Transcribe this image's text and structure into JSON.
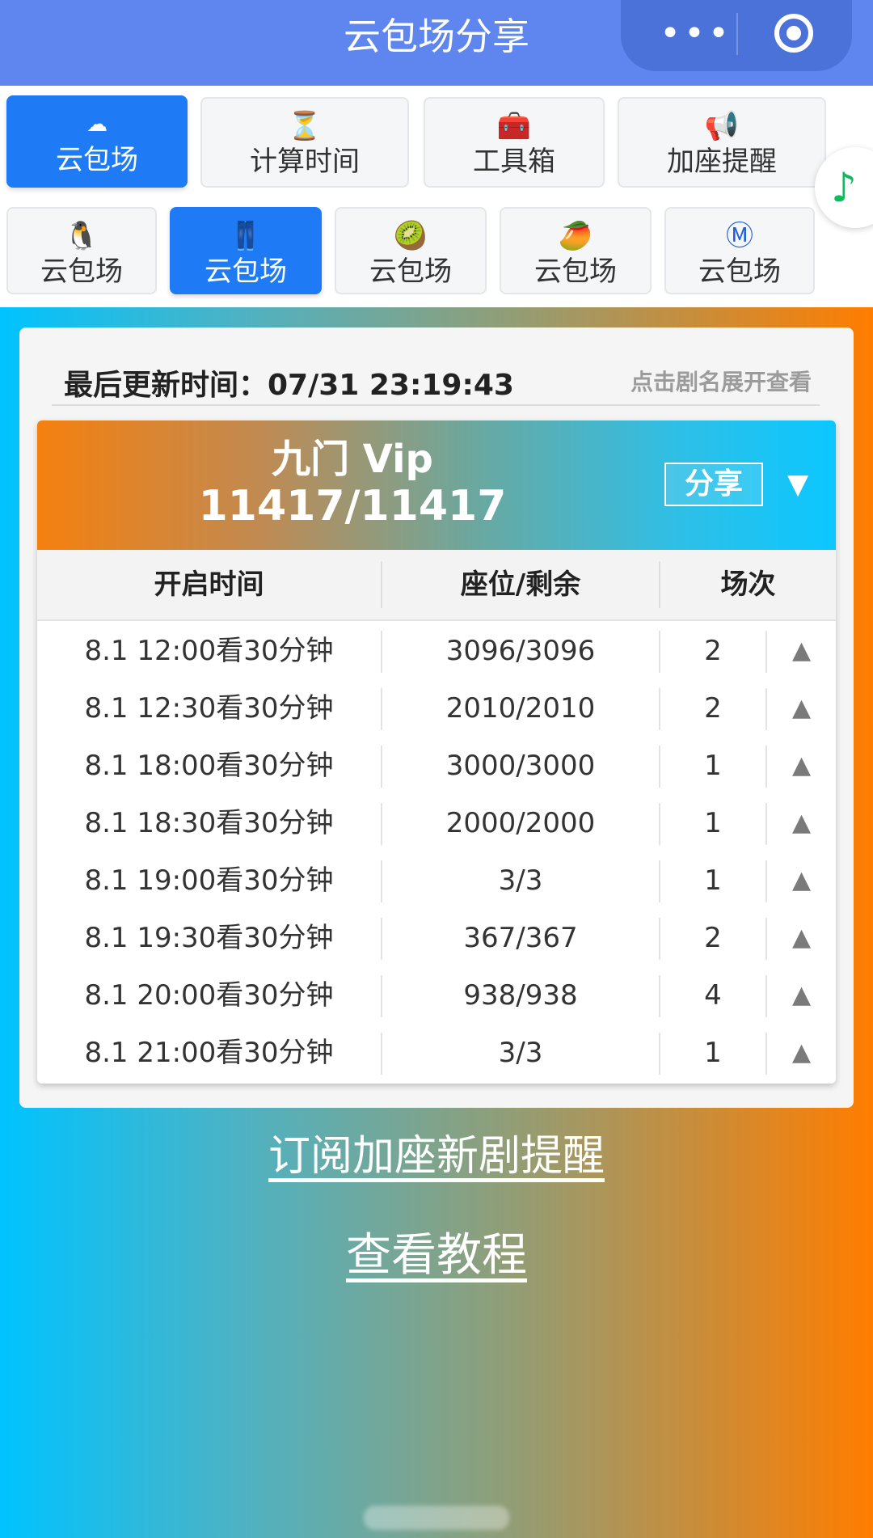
{
  "app": {
    "title": "云包场分享",
    "more_glyph": "•••"
  },
  "tabs_row1": [
    {
      "icon": "cloud-icon",
      "glyph": "☁",
      "label": "云包场",
      "active": true
    },
    {
      "icon": "hourglass-icon",
      "glyph": "⏳",
      "label": "计算时间",
      "active": false
    },
    {
      "icon": "toolbox-icon",
      "glyph": "🧰",
      "label": "工具箱",
      "active": false
    },
    {
      "icon": "megaphone-icon",
      "glyph": "📢",
      "label": "加座提醒",
      "active": false
    }
  ],
  "tabs_row2": [
    {
      "icon": "penguin-icon",
      "glyph": "🐧",
      "label": "云包场",
      "active": false
    },
    {
      "icon": "jeans-icon",
      "glyph": "👖",
      "label": "云包场",
      "active": true
    },
    {
      "icon": "kiwi-icon",
      "glyph": "🥝",
      "label": "云包场",
      "active": false
    },
    {
      "icon": "mango-icon",
      "glyph": "🥭",
      "label": "云包场",
      "active": false
    },
    {
      "icon": "m-circle-icon",
      "glyph": "Ⓜ",
      "label": "云包场",
      "active": false
    }
  ],
  "music": {
    "icon": "music-note-icon",
    "glyph": "♪",
    "color": "#12b85e"
  },
  "card": {
    "update_label": "最后更新时间：07/31 23:19:43",
    "hint": "点击剧名展开查看"
  },
  "show": {
    "title": "九门 Vip",
    "count": "11417/11417",
    "share_label": "分享",
    "expand_glyph": "▼"
  },
  "table": {
    "headers": [
      "开启时间",
      "座位/剩余",
      "场次"
    ],
    "rows": [
      {
        "time": "8.1 12:00看30分钟",
        "seats": "3096/3096",
        "sessions": "2"
      },
      {
        "time": "8.1 12:30看30分钟",
        "seats": "2010/2010",
        "sessions": "2"
      },
      {
        "time": "8.1 18:00看30分钟",
        "seats": "3000/3000",
        "sessions": "1"
      },
      {
        "time": "8.1 18:30看30分钟",
        "seats": "2000/2000",
        "sessions": "1"
      },
      {
        "time": "8.1 19:00看30分钟",
        "seats": "3/3",
        "sessions": "1"
      },
      {
        "time": "8.1 19:30看30分钟",
        "seats": "367/367",
        "sessions": "2"
      },
      {
        "time": "8.1 20:00看30分钟",
        "seats": "938/938",
        "sessions": "4"
      },
      {
        "time": "8.1 21:00看30分钟",
        "seats": "3/3",
        "sessions": "1"
      }
    ],
    "row_arrow_glyph": "▲"
  },
  "links": {
    "subscribe": "订阅加座新剧提醒",
    "tutorial": "查看教程"
  },
  "colors": {
    "titlebar": "#5f86ee",
    "active_tab": "#1f7bf5",
    "gradient_left": "#00c3ff",
    "gradient_right": "#ff7d00"
  }
}
